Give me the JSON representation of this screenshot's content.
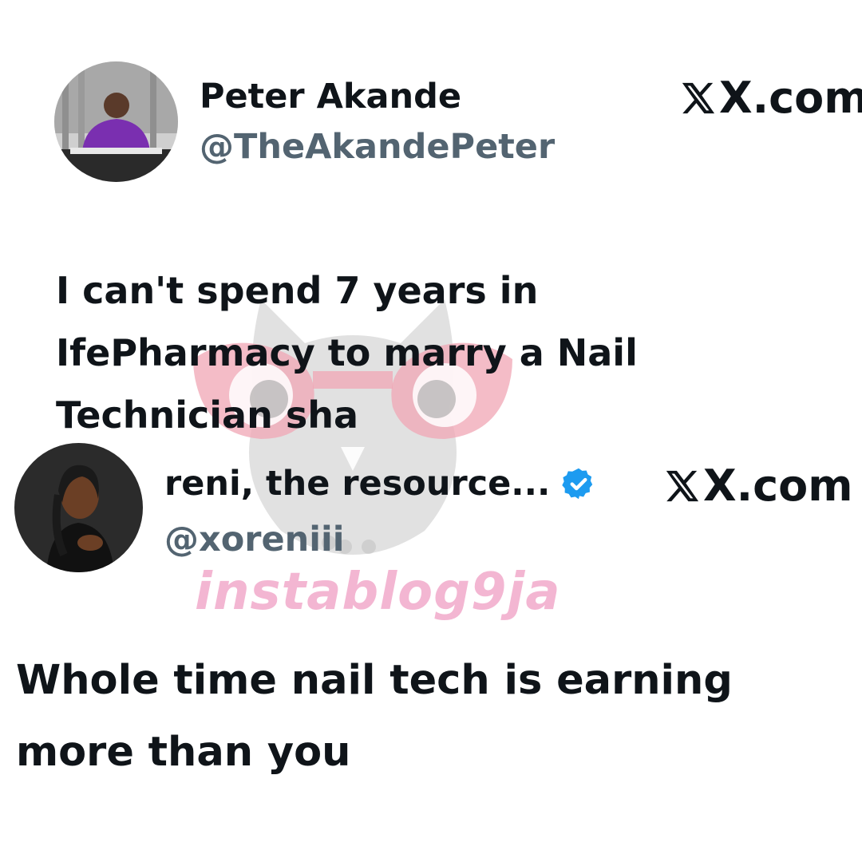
{
  "watermark": {
    "text": "instablog9ja",
    "color": "#f3b6d2"
  },
  "tweets": [
    {
      "author_name": "Peter Akande",
      "handle": "@TheAkandePeter",
      "source": "X.com",
      "verified": false,
      "avatar_icon": "profile-photo",
      "text": "I can't spend 7 years in IfePharmacy to marry a Nail Technician sha"
    },
    {
      "author_name": "reni, the resource...",
      "handle": "@xoreniii",
      "source": "X.com",
      "verified": true,
      "avatar_icon": "profile-photo",
      "text": "Whole time nail tech is earning more than you"
    }
  ],
  "colors": {
    "text": "#0f1419",
    "handle": "#536471",
    "verified": "#1d9bf0"
  }
}
